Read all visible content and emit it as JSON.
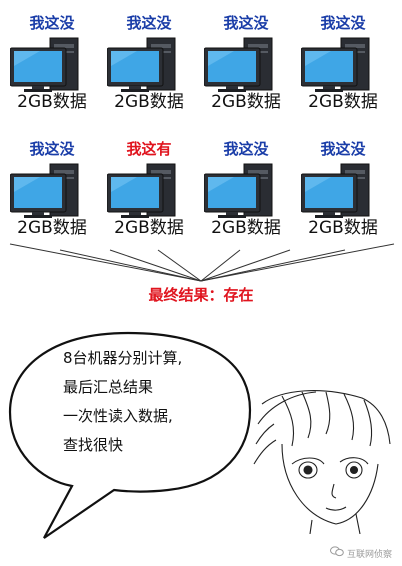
{
  "colors": {
    "normal_status": "#1a3da8",
    "hit_status": "#e0141e",
    "screen": "#3fa6e6"
  },
  "machines": [
    {
      "status": "我这没",
      "highlight": false,
      "data_label": "2GB数据"
    },
    {
      "status": "我这没",
      "highlight": false,
      "data_label": "2GB数据"
    },
    {
      "status": "我这没",
      "highlight": false,
      "data_label": "2GB数据"
    },
    {
      "status": "我这没",
      "highlight": false,
      "data_label": "2GB数据"
    },
    {
      "status": "我这没",
      "highlight": false,
      "data_label": "2GB数据"
    },
    {
      "status": "我这有",
      "highlight": true,
      "data_label": "2GB数据"
    },
    {
      "status": "我这没",
      "highlight": false,
      "data_label": "2GB数据"
    },
    {
      "status": "我这没",
      "highlight": false,
      "data_label": "2GB数据"
    }
  ],
  "result": "最终结果：存在",
  "bubble": {
    "lines": [
      "8台机器分别计算,",
      "最后汇总结果",
      "一次性读入数据,",
      "查找很快"
    ]
  },
  "watermark": {
    "icon": "wechat-icon",
    "text": "互联网侦察"
  }
}
